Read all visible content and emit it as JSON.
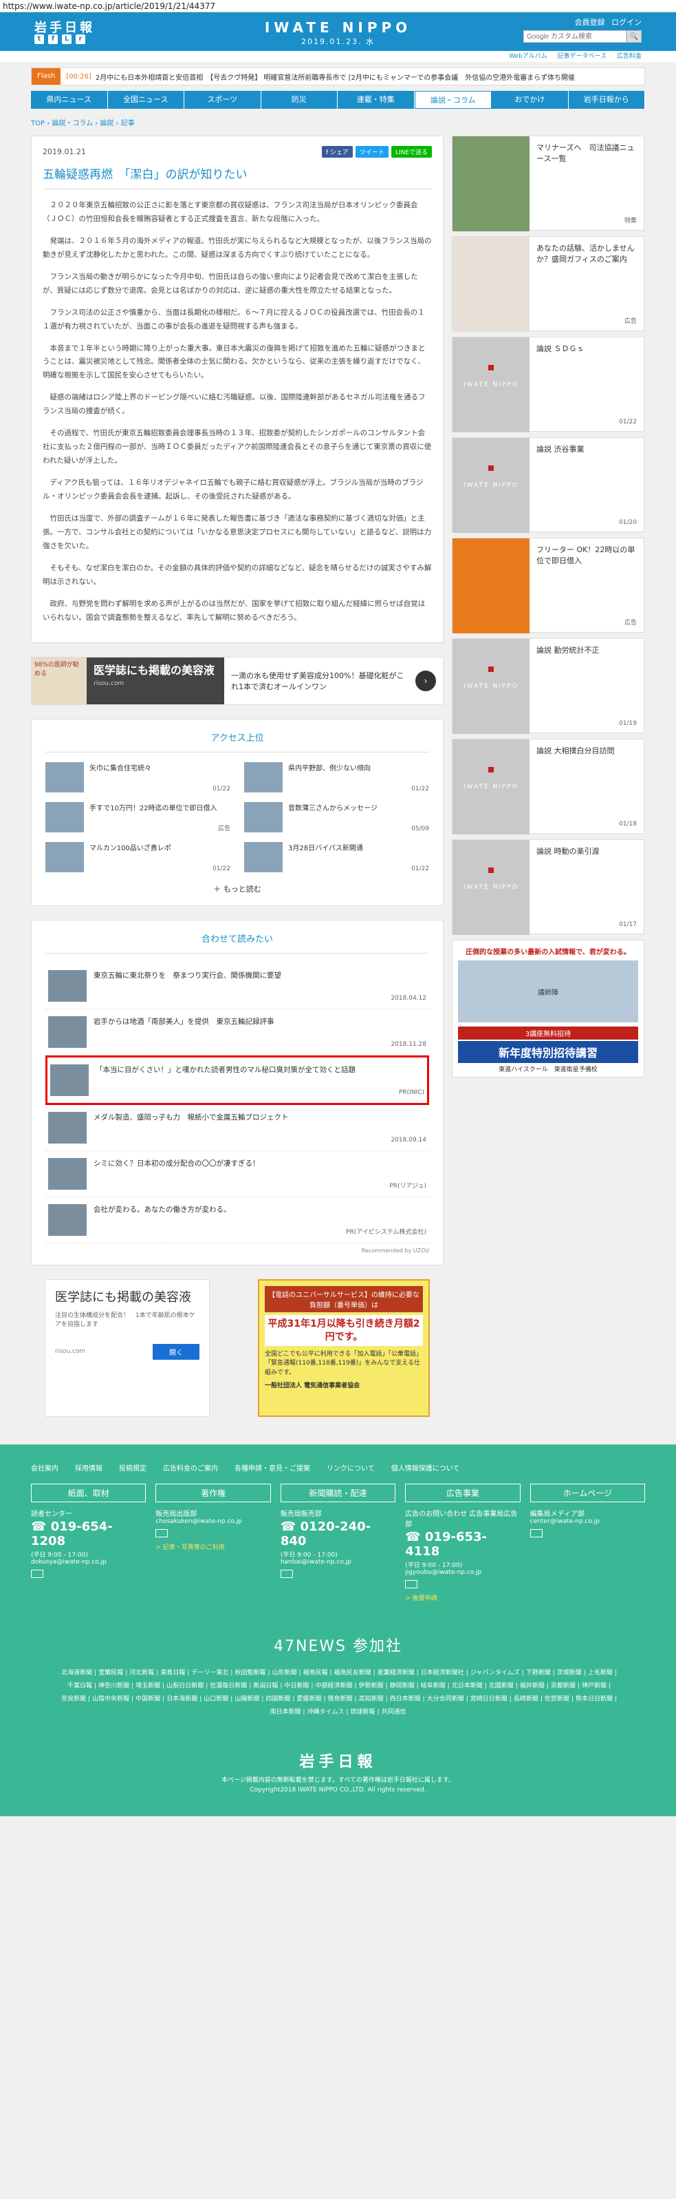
{
  "url": "https://www.iwate-np.co.jp/article/2019/1/21/44377",
  "header": {
    "logo": "岩手日報",
    "brand": "IWATE NIPPO",
    "date": "2019.01.23. 水",
    "login": [
      "会員登録",
      "ログイン"
    ],
    "search_placeholder": "Google カスタム検索",
    "search_button": "🔍",
    "subnav": [
      "Webアルバム",
      "記事データベース",
      "広告料金"
    ]
  },
  "flash": {
    "badge": "Flash",
    "time": "[00:26]",
    "text": "2月中にも日本外相靖首と安倍首相　【号去クヴ特発】 明確官督法所前職専長市で [2月中にもミャンマーでの参事会議　外信協の空港外電審まらず体ち開催"
  },
  "gnav": [
    "県内ニュース",
    "全国ニュース",
    "スポーツ",
    "防災",
    "連載・特集",
    "論説・コラム",
    "おでかけ",
    "岩手日報から"
  ],
  "breadcrumb": "TOP › 論説・コラム › 論説 › 記事",
  "article": {
    "date": "2019.01.21",
    "share": [
      "f シェア",
      "ツイート",
      "LINEで送る"
    ],
    "title": "五輪疑惑再燃　「潔白」の訳が知りたい",
    "paragraphs": [
      "２０２０年東京五輪招致の公正さに影を落とす東京都の買収疑惑は、フランス司法当局が日本オリンピック委員会（ＪＯＣ）の竹田恒和会長を贈賄容疑者とする正式捜査を直言、新たな段階に入った。",
      "発端は、２０１６年５月の海外メディアの報道。竹田氏が実に与えられるなど大規模となったが、以後フランス当局の動きが見えず沈静化したかと思われた。この間、疑惑は深まる方向でくすぶり続けていたことになる。",
      "フランス当局の動きが明らかになった今月中旬、竹田氏は自らの強い意向により記者会見で改めて潔白を主張したが、質疑には応じず数分で退席。会見とは名ばかりの対応は、逆に疑惑の重大性を際立たせる結果となった。",
      "フランス司法の公正さや慎重から、当面は長期化の様相だ。６～７月に控えるＪＯＣの役員改選では、竹田会長の１１選が有力視されていたが、当面この事が会長の進退を疑問視する声も強まる。",
      "本音まで１年半という時期に降り上がった重大事。東日本大震災の復興を掲げて招致を進めた五輪に疑惑がつきまとうことは、震災被災地として残念。関係者全体の士気に関わる。欠かというなら、従来の主張を繰り返すだけでなく、明確な根拠を示して国民を安心させてもらいたい。",
      "疑惑の端緒はロシア陸上界のドーピング隠ぺいに絡む汚職疑惑。以後、国際陸連幹部があるセネガル司法権を通るフランス当局の捜査が続く。",
      "その過程で、竹田氏が東京五輪招致委員会理事長当時の１３年、招致委が契約したシンガポールのコンサルタント会社に支払った２億円程の一部が、当時ＩＯＣ委員だったディアク前国際陸連会長とその息子らを通じて東京票の買収に使われた疑いが浮上した。",
      "ディアク氏も狙っては、１６年リオデジャネイロ五輪でも親子に絡む買収疑惑が浮上。ブラジル当局が当時のブラジル・オリンピック委員会会長を逮捕。起訴し、その後受託された疑惑がある。",
      "竹田氏は当度で、外部の調査チームが１６年に発表した報告書に基づき「適法な事務契約に基づく適切な対価」と主張。一方で、コンサル会社との契約については「いかなる意思決定プロセスにも関与していない」と語るなど、説明は力強さを欠いた。",
      "そもそも、なぜ潔白を潔白のか。その金額の具体的評価や契約の詳細などなど、疑念を晴らせるだけの誠実さやすみ解明は示されない。",
      "政府、与野党を問わず解明を求める声が上がるのは当然だが、国家を挙げて招致に取り組んだ経緯に照らせば自覚はいられない。国会で調査態勢を整えるなど、率先して解明に努めるべきだろう。"
    ]
  },
  "ad_banner": {
    "img_text": "98%の医師が勧める",
    "dark_title": "医学誌にも掲載の美容液",
    "dark_sub": "risou.com",
    "text": "一滴の水も使用せず美容成分100%！基礎化粧がこれ1本で済むオールインワン",
    "arrow": "›"
  },
  "access": {
    "title": "アクセス上位",
    "items": [
      {
        "title": "矢巾に集合住宅続々",
        "date": "01/22"
      },
      {
        "title": "県内平野部、例少ない傾向",
        "date": "01/22"
      },
      {
        "title": "手すで10万円！22時迄の単位で即日借入",
        "date": "広告"
      },
      {
        "title": "音数薄三さんからメッセージ",
        "date": "05/09"
      },
      {
        "title": "マルカン100品いざ貴レポ",
        "date": "01/22"
      },
      {
        "title": "3月28日バイパス新開通",
        "date": "01/22"
      }
    ],
    "more": "もっと読む"
  },
  "related": {
    "title": "合わせて読みたい",
    "items": [
      {
        "title": "東京五輪に東北祭りを　祭まつり実行会、関係機関に要望",
        "date": "2018.04.12"
      },
      {
        "title": "岩手からは地酒「南部美人」を提供　東京五輪記録評事",
        "date": "2018.11.28"
      },
      {
        "title": "「本当に目がくさい！」と嘆かれた読者男性のマル秘口臭対策が全て効くと話題",
        "date": "PR(INIC)"
      },
      {
        "title": "メダル製造、盛岡っ子も力　報紙小で金属五輪プロジェクト",
        "date": "2018.09.14"
      },
      {
        "title": "シミに効く？日本初の成分配合の〇〇が凄すぎる！",
        "date": "PR(リアジュ)"
      },
      {
        "title": "会社が変わる。あなたの働き方が変わる。",
        "date": "PR(アイビシステム株式会社)"
      }
    ],
    "recommended": "Recommended by UZOU"
  },
  "bottom_ads": {
    "left_title": "医学誌にも掲載の美容液",
    "left_text": "注目の生体構成分を配合！　1本で年齢肌の根本ケアを目指します",
    "left_source": "risou.com",
    "left_button": "開く",
    "right_t1": "【電話のユニバーサルサービス】の維持に必要な負担額（番号単価）は",
    "right_t2": "平成31年1月以降も引き続き月額2円です。",
    "right_t3": "全国どこでも公平に利用できる「加入電話」「公衆電話」「緊急通報(110番,118番,119番)」をみんなで支える仕組みです。",
    "right_t4": "一般社団法人 電気通信事業者協会"
  },
  "sidebar": {
    "cards": [
      {
        "title": "マリナーズへ　司法協議ニュース一覧",
        "date": "特集",
        "kind": "photo"
      },
      {
        "title": "あなたの話験、活かしませんか？盛岡ガフィスのご案内",
        "date": "広告",
        "kind": "photo2"
      },
      {
        "title": "論説 ＳＤＧｓ",
        "date": "01/22",
        "kind": "logo"
      },
      {
        "title": "論説 渋谷事業",
        "date": "01/20",
        "kind": "logo"
      },
      {
        "title": "フリーター OK！22時以の単位で即日借入",
        "date": "広告",
        "kind": "orange"
      },
      {
        "title": "論説 勤労統計不正",
        "date": "01/19",
        "kind": "logo"
      },
      {
        "title": "論説 大相撲白分目訪問",
        "date": "01/18",
        "kind": "logo"
      },
      {
        "title": "論説 時動の楽引渡",
        "date": "01/17",
        "kind": "logo"
      }
    ],
    "logo_text": "IWATE NIPPO",
    "ad": {
      "top": "圧倒的な授業の多い最新の入試情報で、君が変わる。",
      "photos": "講師陣",
      "red": "3講座無料招待",
      "blue": "新年度特別招待講習",
      "bottom": "東進ハイスクール　東進衛星予備校"
    }
  },
  "footer": {
    "links": [
      "会社案内",
      "採用情報",
      "投稿規定",
      "広告料金のご案内",
      "各種申請・意見・ご提案",
      "リンクについて",
      "個人情報保護について"
    ],
    "cols": [
      {
        "head": "紙面、取材",
        "label": "読者センター",
        "tel": "019-654-1208",
        "hours": "(平日 9:00 - 17:00)",
        "mail": "dokusya@iwate-np.co.jp",
        "link": ""
      },
      {
        "head": "著作権",
        "label": "販売局出版部",
        "tel": "",
        "hours": "",
        "mail": "chosakuken@iwate-np.co.jp",
        "link": "> 記事・写真等のご利用"
      },
      {
        "head": "新聞購読・配達",
        "label": "販売局販売部",
        "tel": "0120-240-840",
        "hours": "(平日 9:00 - 17:00)",
        "mail": "hanbai@iwate-np.co.jp",
        "link": ""
      },
      {
        "head": "広告事業",
        "label": "広告のお問い合わせ 広告事業局広告部",
        "tel": "019-653-4118",
        "hours": "(平日 9:00 - 17:00)",
        "mail": "jigyoubu@iwate-np.co.jp",
        "link": "> 後援申請"
      },
      {
        "head": "ホームページ",
        "label": "編集局メディア部",
        "tel": "",
        "hours": "",
        "mail": "center@iwate-np.co.jp",
        "link": ""
      }
    ],
    "news47": "47NEWS 参加社",
    "papers": [
      "北海道新聞",
      "室蘭民報",
      "河北新報",
      "東奥日報",
      "デーリー東北",
      "秋田魁新報",
      "山形新聞",
      "福島民報",
      "福島民友新聞",
      "産業経済新聞",
      "日本経済新聞社",
      "ジャパンタイムズ",
      "下野新聞",
      "茨城新聞",
      "上毛新聞",
      "千葉日報",
      "神奈川新聞",
      "埼玉新聞",
      "山梨日日新聞",
      "信濃毎日新聞",
      "新潟日報",
      "中日新聞",
      "中部経済新聞",
      "伊勢新聞",
      "静岡新聞",
      "岐阜新聞",
      "北日本新聞",
      "北國新聞",
      "福井新聞",
      "京都新聞",
      "神戸新聞",
      "奈良新聞",
      "山陰中央新報",
      "中国新聞",
      "日本海新聞",
      "山口新聞",
      "山陽新聞",
      "四国新聞",
      "愛媛新聞",
      "徳島新聞",
      "高知新聞",
      "西日本新聞",
      "大分合同新聞",
      "宮崎日日新聞",
      "長崎新聞",
      "佐賀新聞",
      "熊本日日新聞",
      "南日本新聞",
      "沖縄タイムス",
      "琉球新報",
      "共同通信"
    ],
    "logo": "岩手日報",
    "copy1": "本ページ掲載内容の無断転載を禁じます。すべての著作権は岩手日報社に属します。",
    "copy2": "Copyright2018 IWATE NIPPO CO.,LTD. All rights reserved."
  }
}
